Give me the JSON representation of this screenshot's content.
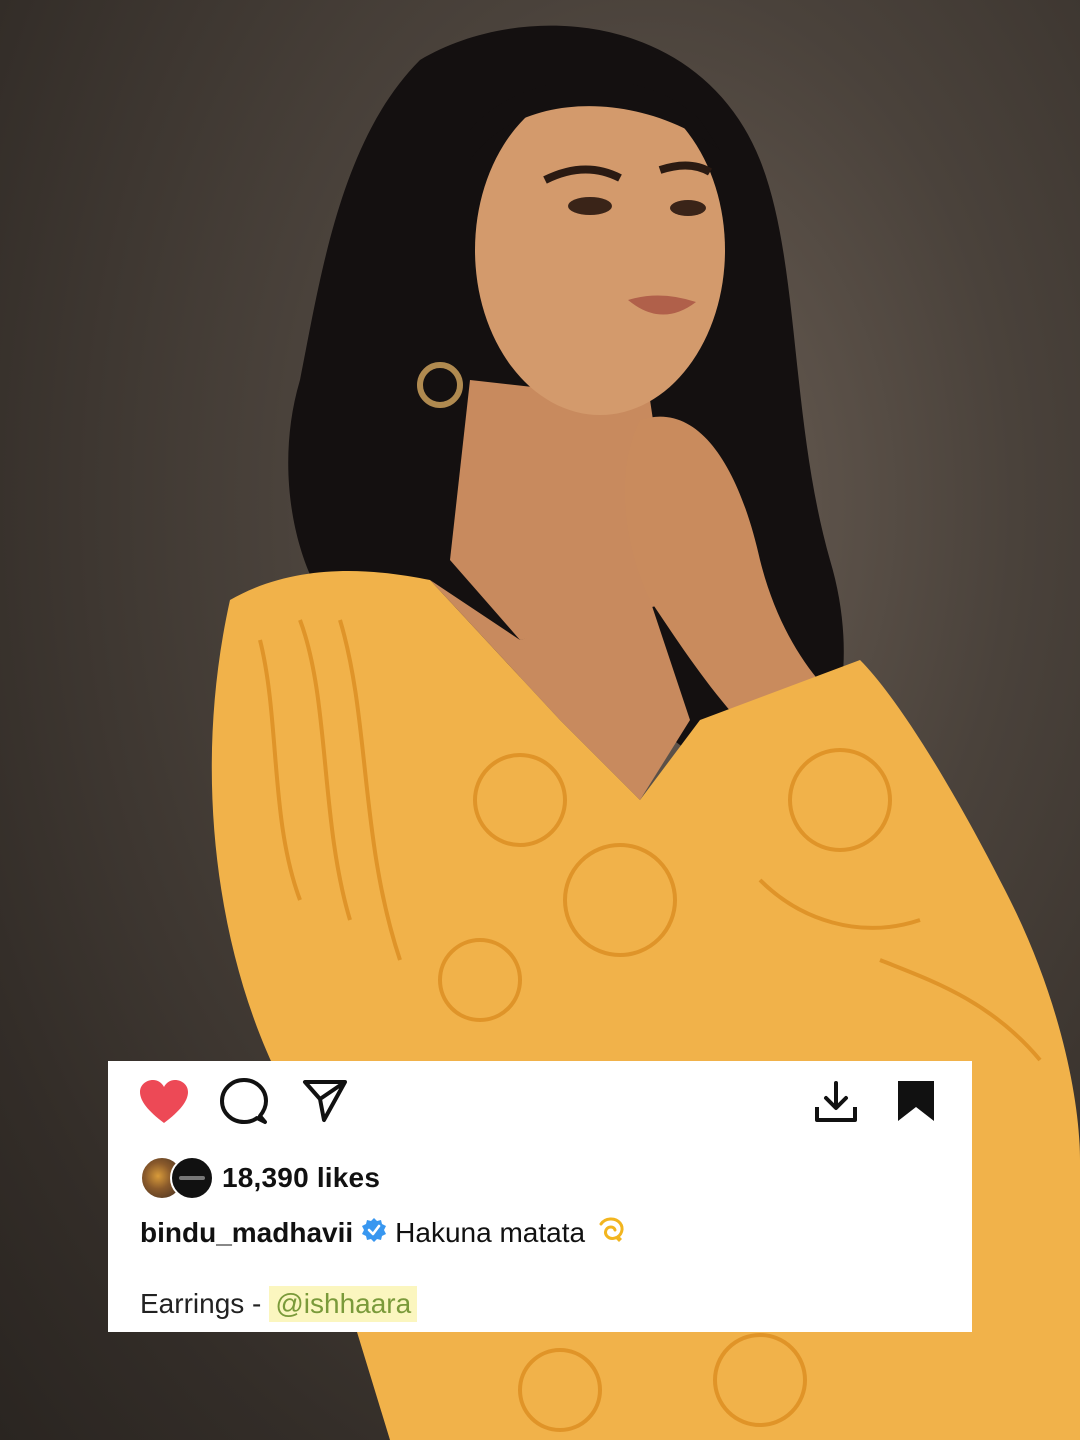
{
  "post": {
    "likes": "18,390 likes",
    "username": "bindu_madhavii",
    "caption": "Hakuna matata",
    "credit_label": "Earrings -",
    "credit_mention": "@ishhaara"
  },
  "icons": {
    "like": "heart-icon",
    "comment": "comment-icon",
    "share": "send-icon",
    "download": "download-icon",
    "save": "bookmark-icon",
    "verified": "verified-badge-icon",
    "emoji": "dizzy-emoji-icon"
  },
  "colors": {
    "heart": "#ed4956",
    "verified": "#3897f0",
    "mention_highlight": "#fbf6bf",
    "dress": "#f1b24a"
  }
}
